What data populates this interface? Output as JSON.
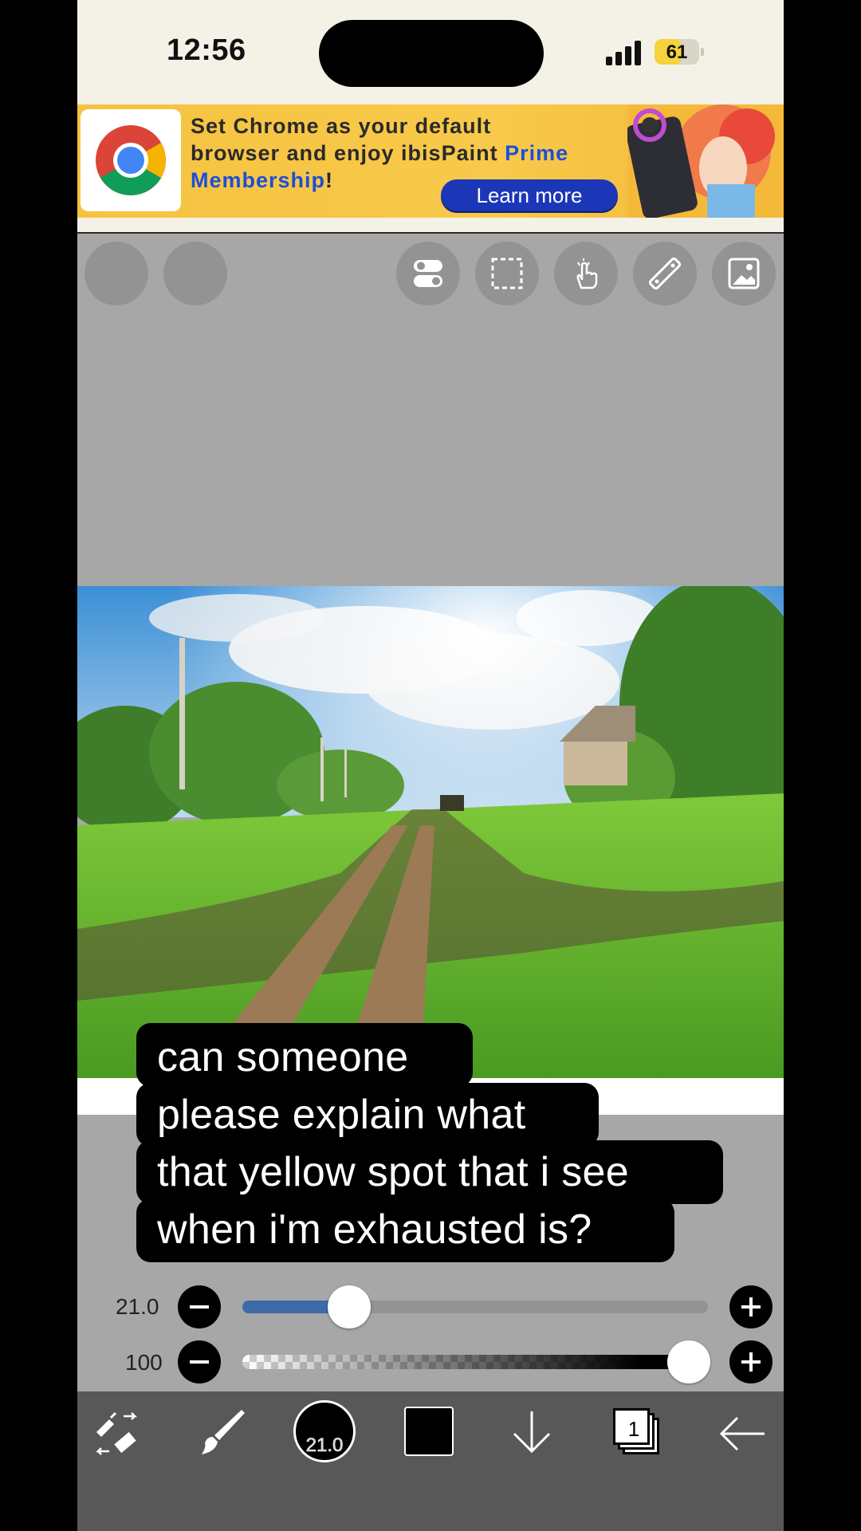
{
  "status_bar": {
    "time": "12:56",
    "battery": "61",
    "battery_level": 0.61
  },
  "ad": {
    "line1": "Set Chrome as your default",
    "line2": "browser and enjoy ibisPaint ",
    "line2_highlight": "Prime",
    "line3_highlight": "Membership",
    "line3_suffix": "!",
    "cta": "Learn more",
    "icon": "chrome-logo-icon",
    "colors": {
      "background": "#f6c341",
      "button": "#1c36b8",
      "highlight": "#1b4fd8"
    }
  },
  "toolbar": {
    "icons": [
      "undo-icon",
      "redo-icon",
      "toggle-settings-icon",
      "selection-icon",
      "gesture-hand-icon",
      "ruler-icon",
      "image-icon"
    ]
  },
  "caption": {
    "lines": [
      "can someone",
      "please explain what",
      "that yellow spot that i see",
      "when i'm exhausted is?"
    ]
  },
  "brush": {
    "size_label": "21.0",
    "size_fraction": 0.23,
    "opacity_label": "100",
    "opacity_fraction": 1.0,
    "slider_color": "#3e6aa8"
  },
  "bottom_bar": {
    "brush_size": "21.0",
    "current_color": "#000000",
    "layer_count": "1",
    "icons": [
      "tool-selector-icon",
      "brush-icon",
      "brush-size-icon",
      "color-icon",
      "download-icon",
      "layers-icon",
      "back-arrow-icon"
    ]
  }
}
